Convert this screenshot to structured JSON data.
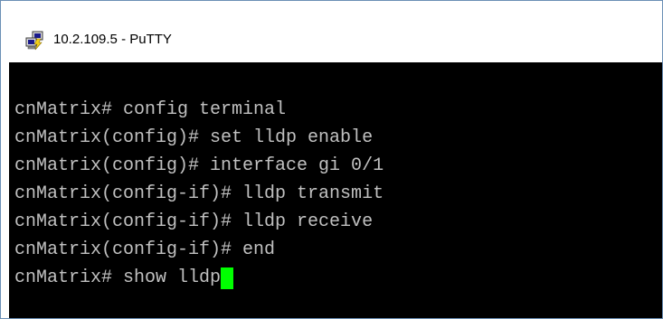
{
  "window": {
    "title": "10.2.109.5 - PuTTY",
    "icon": "putty-icon"
  },
  "terminal": {
    "lines": [
      "cnMatrix# config terminal",
      "cnMatrix(config)# set lldp enable",
      "cnMatrix(config)# interface gi 0/1",
      "cnMatrix(config-if)# lldp transmit",
      "cnMatrix(config-if)# lldp receive",
      "cnMatrix(config-if)# end",
      "cnMatrix# show lldp"
    ],
    "foreground_color": "#c0c0c0",
    "background_color": "#000000",
    "cursor_color": "#00ff00"
  }
}
